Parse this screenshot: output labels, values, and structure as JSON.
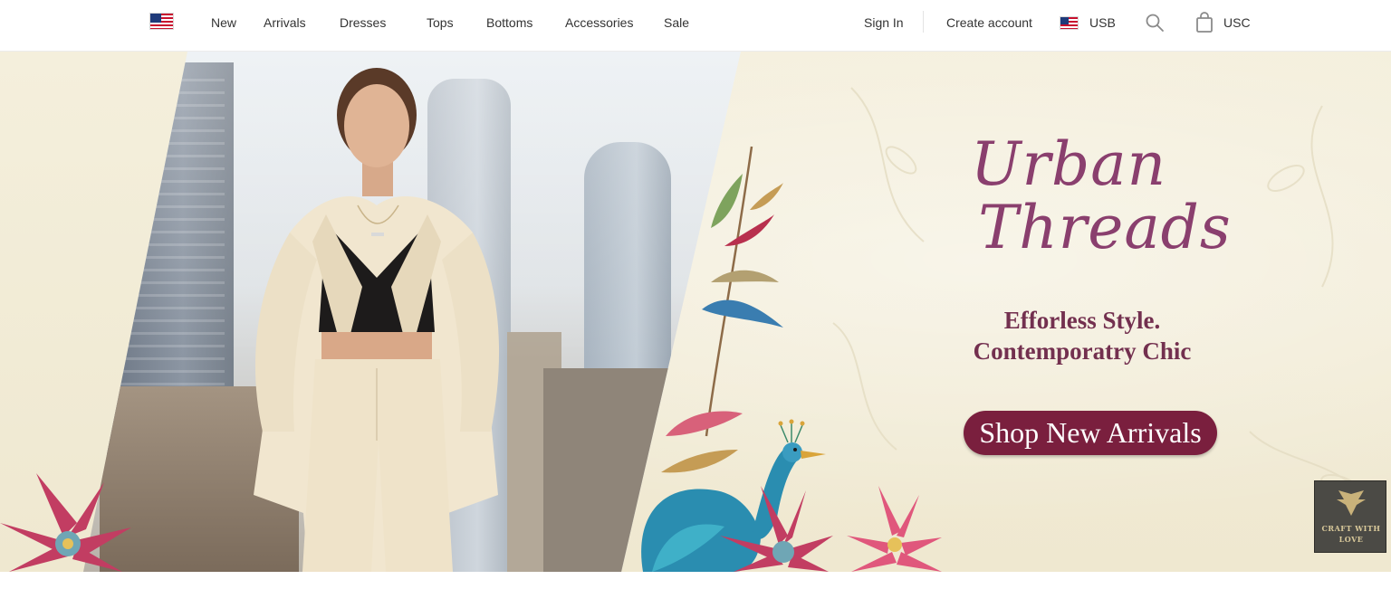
{
  "nav": {
    "flag_icon": "us-flag-icon",
    "links": [
      "New",
      "Arrivals",
      "Dresses",
      "Tops",
      "Bottoms",
      "Accessories",
      "Sale"
    ],
    "sign_in": "Sign In",
    "create_account": "Create account",
    "currency": "USB",
    "search_icon": "search-icon",
    "bag_icon": "shopping-bag-icon",
    "cart_label": "USC"
  },
  "hero": {
    "brand_line1": "Urban",
    "brand_line2": "Threads",
    "tagline_line1": "Efforless Style.",
    "tagline_line2": "Contemporatry Chic",
    "cta_label": "Shop New Arrivals",
    "badge_text_line1": "CRAFT WITH",
    "badge_text_line2": "LOVE"
  },
  "colors": {
    "brand": "#8a3f6e",
    "cta_bg": "#7a1f3e",
    "cream": "#f2edd9"
  }
}
